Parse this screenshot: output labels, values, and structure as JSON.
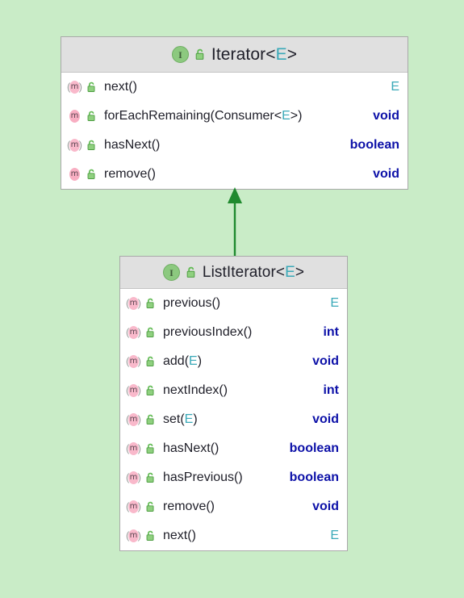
{
  "diagram": {
    "kind": "uml-class-diagram",
    "background_color": "#c9ecc7",
    "relationship": {
      "name": "implements-inheritance-arrow",
      "from": "ListIterator<E>",
      "to": "Iterator<E>",
      "color": "#1f8a2e",
      "arrow_style": "solid-line-closed-filled-triangle"
    }
  },
  "classes": [
    {
      "id": "iterator",
      "stereotype_icon": "interface-icon",
      "stereotype_letter": "I",
      "visibility_icon": "unlocked-padlock-icon",
      "name": "Iterator",
      "generic_open": "<",
      "generic_param": "E",
      "generic_close": ">",
      "members": [
        {
          "icon": "abstract-method-icon",
          "glyph": "m",
          "abstract": true,
          "name": "next()",
          "type": "E",
          "type_style": "plain"
        },
        {
          "icon": "method-icon",
          "glyph": "m",
          "abstract": false,
          "name": "forEachRemaining(Consumer<E>)",
          "type": "void",
          "type_style": "bold"
        },
        {
          "icon": "abstract-method-icon",
          "glyph": "m",
          "abstract": true,
          "name": "hasNext()",
          "type": "boolean",
          "type_style": "bold"
        },
        {
          "icon": "method-icon",
          "glyph": "m",
          "abstract": false,
          "name": "remove()",
          "type": "void",
          "type_style": "bold"
        }
      ]
    },
    {
      "id": "listiterator",
      "stereotype_icon": "interface-icon",
      "stereotype_letter": "I",
      "visibility_icon": "unlocked-padlock-icon",
      "name": "ListIterator",
      "generic_open": "<",
      "generic_param": "E",
      "generic_close": ">",
      "members": [
        {
          "icon": "abstract-method-icon",
          "glyph": "m",
          "abstract": true,
          "name": "previous()",
          "type": "E",
          "type_style": "plain"
        },
        {
          "icon": "abstract-method-icon",
          "glyph": "m",
          "abstract": true,
          "name": "previousIndex()",
          "type": "int",
          "type_style": "bold"
        },
        {
          "icon": "abstract-method-icon",
          "glyph": "m",
          "abstract": true,
          "name": "add(E)",
          "type": "void",
          "type_style": "bold"
        },
        {
          "icon": "abstract-method-icon",
          "glyph": "m",
          "abstract": true,
          "name": "nextIndex()",
          "type": "int",
          "type_style": "bold"
        },
        {
          "icon": "abstract-method-icon",
          "glyph": "m",
          "abstract": true,
          "name": "set(E)",
          "type": "void",
          "type_style": "bold"
        },
        {
          "icon": "abstract-method-icon",
          "glyph": "m",
          "abstract": true,
          "name": "hasNext()",
          "type": "boolean",
          "type_style": "bold"
        },
        {
          "icon": "abstract-method-icon",
          "glyph": "m",
          "abstract": true,
          "name": "hasPrevious()",
          "type": "boolean",
          "type_style": "bold"
        },
        {
          "icon": "abstract-method-icon",
          "glyph": "m",
          "abstract": true,
          "name": "remove()",
          "type": "void",
          "type_style": "bold"
        },
        {
          "icon": "abstract-method-icon",
          "glyph": "m",
          "abstract": true,
          "name": "next()",
          "type": "E",
          "type_style": "plain"
        }
      ]
    }
  ],
  "colors": {
    "background": "#c9ecc7",
    "box_fill": "#ffffff",
    "box_border": "#a9a9a9",
    "header_fill": "#e0e0e0",
    "interface_icon": "#8cc97f",
    "padlock_icon": "#63bb55",
    "method_icon": "#f8aec2",
    "type_param": "#3aa9b8",
    "return_type": "#0d11a8",
    "arrow": "#1f8a2e"
  }
}
